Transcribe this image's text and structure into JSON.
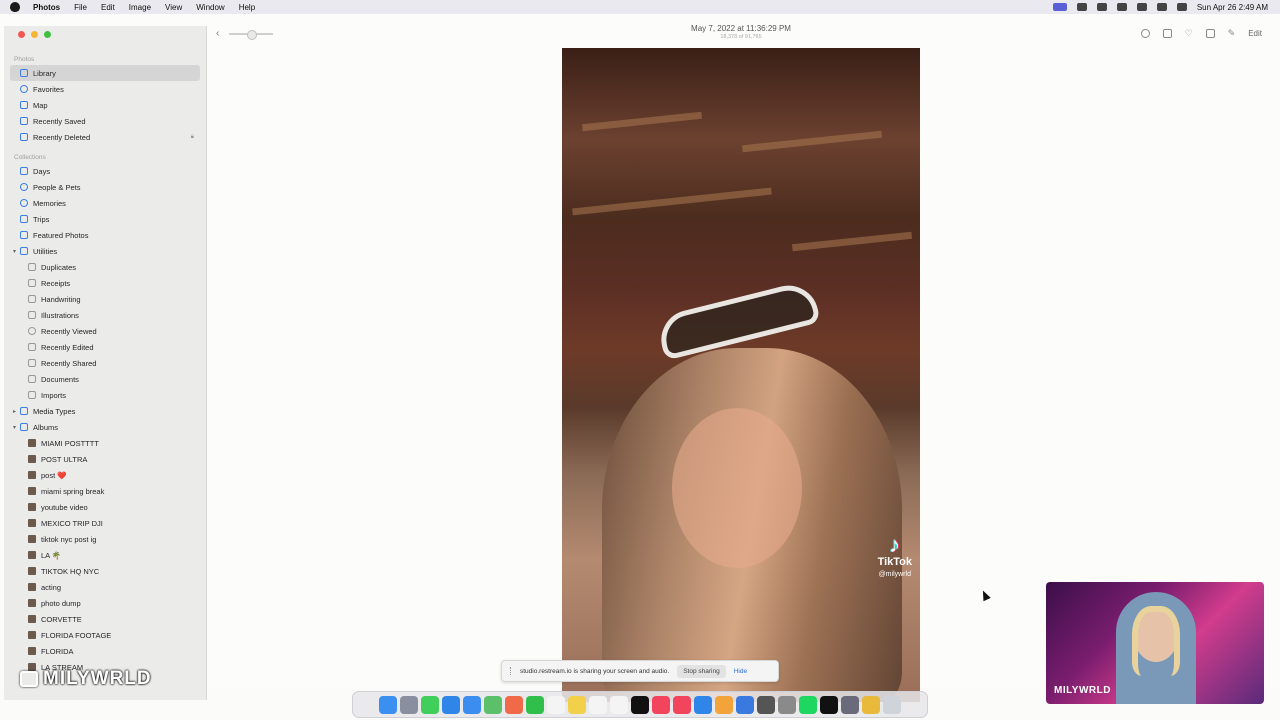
{
  "menubar": {
    "app": "Photos",
    "items": [
      "File",
      "Edit",
      "Image",
      "View",
      "Window",
      "Help"
    ],
    "clock": "Sun Apr 26  2:49 AM"
  },
  "sidebar": {
    "section_photos": "Photos",
    "photos_items": [
      "Library",
      "Favorites",
      "Map",
      "Recently Saved",
      "Recently Deleted"
    ],
    "section_collections": "Collections",
    "collection_items": [
      "Days",
      "People & Pets",
      "Memories",
      "Trips",
      "Featured Photos",
      "Utilities"
    ],
    "utilities_items": [
      "Duplicates",
      "Receipts",
      "Handwriting",
      "Illustrations",
      "Recently Viewed",
      "Recently Edited",
      "Recently Shared",
      "Documents",
      "Imports"
    ],
    "media_types": "Media Types",
    "albums": "Albums",
    "album_items": [
      "MIAMI POSTTTT",
      "POST ULTRA",
      "post ❤️",
      "miami spring break",
      "youtube video",
      "MEXICO TRIP DJI",
      "tiktok nyc post ig",
      "LA 🌴",
      "TIKTOK HQ NYC",
      "acting",
      "photo dump",
      "CORVETTE",
      "FLORIDA FOOTAGE",
      "FLORIDA",
      "LA STREAM"
    ]
  },
  "toolbar": {
    "title": "May 7, 2022 at 11:36:29 PM",
    "subtitle": "18,378 of 91,765",
    "edit": "Edit"
  },
  "photo": {
    "tiktok_brand": "TikTok",
    "tiktok_handle": "@milywrld"
  },
  "sharebar": {
    "message": "studio.restream.io is sharing your screen and audio.",
    "stop": "Stop sharing",
    "hide": "Hide"
  },
  "webcam": {
    "label": "MILYWRLD"
  },
  "watermark": {
    "text": "MILYWRLD"
  },
  "colors": {
    "accent": "#3d7fe0",
    "close": "#f2584f",
    "minimize": "#f7b632",
    "maximize": "#3ec13f"
  },
  "dock": {
    "icons": [
      {
        "name": "finder-icon",
        "color": "#3b8ff0"
      },
      {
        "name": "launchpad-icon",
        "color": "#8a8fa0"
      },
      {
        "name": "messages-icon",
        "color": "#3fcf5a"
      },
      {
        "name": "safari-icon",
        "color": "#2f86e8"
      },
      {
        "name": "mail-icon",
        "color": "#3c8df0"
      },
      {
        "name": "maps-icon",
        "color": "#5cbf6a"
      },
      {
        "name": "photos-icon",
        "color": "#f06a4a"
      },
      {
        "name": "facetime-icon",
        "color": "#2fbf4a"
      },
      {
        "name": "calendar-icon",
        "color": "#f4f4f4"
      },
      {
        "name": "notes-icon",
        "color": "#f2d04a"
      },
      {
        "name": "reminders-icon",
        "color": "#f4f4f4"
      },
      {
        "name": "freeform-icon",
        "color": "#f4f4f4"
      },
      {
        "name": "appletv-icon",
        "color": "#111111"
      },
      {
        "name": "music-icon",
        "color": "#f2445c"
      },
      {
        "name": "news-icon",
        "color": "#f2445c"
      },
      {
        "name": "appstore-icon",
        "color": "#2f86e8"
      },
      {
        "name": "pages-icon",
        "color": "#f2a33a"
      },
      {
        "name": "xcode-icon",
        "color": "#3a7ae0"
      },
      {
        "name": "vpn-icon",
        "color": "#555555"
      },
      {
        "name": "settings-icon",
        "color": "#8a8a8a"
      },
      {
        "name": "spotify-icon",
        "color": "#1ed760"
      },
      {
        "name": "capcut-icon",
        "color": "#111111"
      },
      {
        "name": "preview-icon",
        "color": "#6a6a7a"
      },
      {
        "name": "chrome-icon",
        "color": "#e8b93a"
      },
      {
        "name": "trash-icon",
        "color": "#cfd3da"
      }
    ]
  }
}
